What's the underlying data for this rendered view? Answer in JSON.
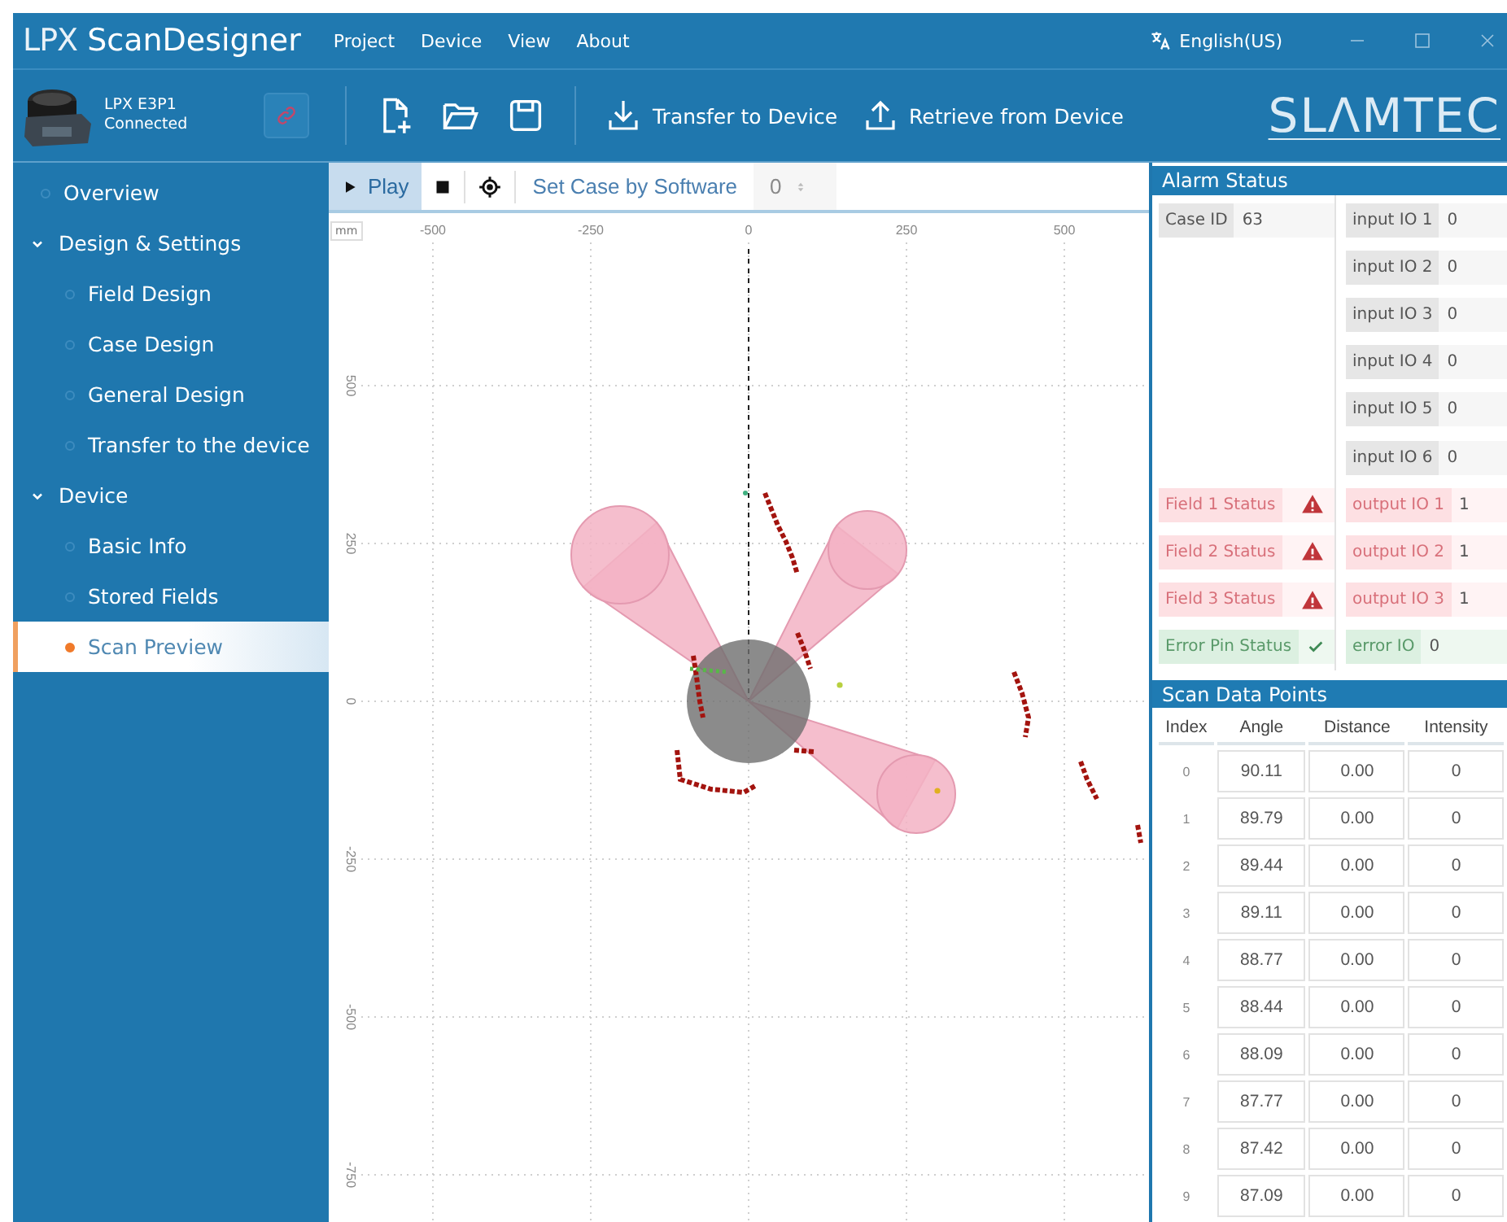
{
  "app": {
    "logo_prefix": "LPX",
    "logo_name": "ScanDesigner",
    "menu": [
      "Project",
      "Device",
      "View",
      "About"
    ],
    "language": "English(US)"
  },
  "device": {
    "name": "LPX E3P1",
    "status": "Connected"
  },
  "toolbar": {
    "actions": [
      {
        "label": "Transfer to Device",
        "kind": "download"
      },
      {
        "label": "Retrieve from Device",
        "kind": "upload"
      }
    ],
    "brand": "SLΛMTEC"
  },
  "sidebar": {
    "items": [
      {
        "label": "Overview",
        "selected": false
      },
      {
        "label": "Design & Settings",
        "expanded": true,
        "children": [
          {
            "label": "Field Design",
            "selected": false
          },
          {
            "label": "Case Design",
            "selected": false
          },
          {
            "label": "General Design",
            "selected": false
          },
          {
            "label": "Transfer to the device",
            "selected": false
          }
        ]
      },
      {
        "label": "Device",
        "expanded": true,
        "children": [
          {
            "label": "Basic Info",
            "selected": false
          },
          {
            "label": "Stored Fields",
            "selected": false
          },
          {
            "label": "Scan Preview",
            "selected": true
          }
        ]
      }
    ]
  },
  "preview_toolbar": {
    "play": {
      "label": "Play",
      "selected": true
    },
    "case_mode": "Set Case by Software",
    "case_value": {
      "value": "0",
      "disabled": true
    }
  },
  "plot": {
    "unit": "mm",
    "x_ticks": [
      "-500",
      "-250",
      "0",
      "250",
      "500"
    ],
    "y_ticks": [
      "500",
      "250",
      "0",
      "-250",
      "-500",
      "-750"
    ]
  },
  "alarm_status": {
    "title": "Alarm Status",
    "rows": [
      {
        "left": {
          "label": "Case ID",
          "value": "63",
          "kind": "plain"
        },
        "right": {
          "label": "input IO 1",
          "value": "0",
          "kind": "plain"
        }
      },
      {
        "right": {
          "label": "input IO 2",
          "value": "0",
          "kind": "plain"
        }
      },
      {
        "right": {
          "label": "input IO 3",
          "value": "0",
          "kind": "plain"
        }
      },
      {
        "right": {
          "label": "input IO 4",
          "value": "0",
          "kind": "plain"
        }
      },
      {
        "right": {
          "label": "input IO 5",
          "value": "0",
          "kind": "plain"
        }
      },
      {
        "right": {
          "label": "input IO 6",
          "value": "0",
          "kind": "plain"
        }
      },
      {
        "left": {
          "label": "Field 1 Status",
          "kind": "alarm"
        },
        "right": {
          "label": "output IO 1",
          "value": "1",
          "kind": "alarm"
        }
      },
      {
        "left": {
          "label": "Field 2 Status",
          "kind": "alarm"
        },
        "right": {
          "label": "output IO 2",
          "value": "1",
          "kind": "alarm"
        }
      },
      {
        "left": {
          "label": "Field 3 Status",
          "kind": "alarm"
        },
        "right": {
          "label": "output IO 3",
          "value": "1",
          "kind": "alarm"
        }
      },
      {
        "left": {
          "label": "Error Pin Status",
          "kind": "ok"
        },
        "right": {
          "label": "error IO",
          "value": "0",
          "kind": "ok"
        }
      }
    ]
  },
  "scan_data": {
    "title": "Scan Data Points",
    "columns": [
      "Index",
      "Angle",
      "Distance",
      "Intensity"
    ],
    "rows": [
      [
        "0",
        "90.11",
        "0.00",
        "0"
      ],
      [
        "1",
        "89.79",
        "0.00",
        "0"
      ],
      [
        "2",
        "89.44",
        "0.00",
        "0"
      ],
      [
        "3",
        "89.11",
        "0.00",
        "0"
      ],
      [
        "4",
        "88.77",
        "0.00",
        "0"
      ],
      [
        "5",
        "88.44",
        "0.00",
        "0"
      ],
      [
        "6",
        "88.09",
        "0.00",
        "0"
      ],
      [
        "7",
        "87.77",
        "0.00",
        "0"
      ],
      [
        "8",
        "87.42",
        "0.00",
        "0"
      ],
      [
        "9",
        "87.09",
        "0.00",
        "0"
      ]
    ]
  }
}
